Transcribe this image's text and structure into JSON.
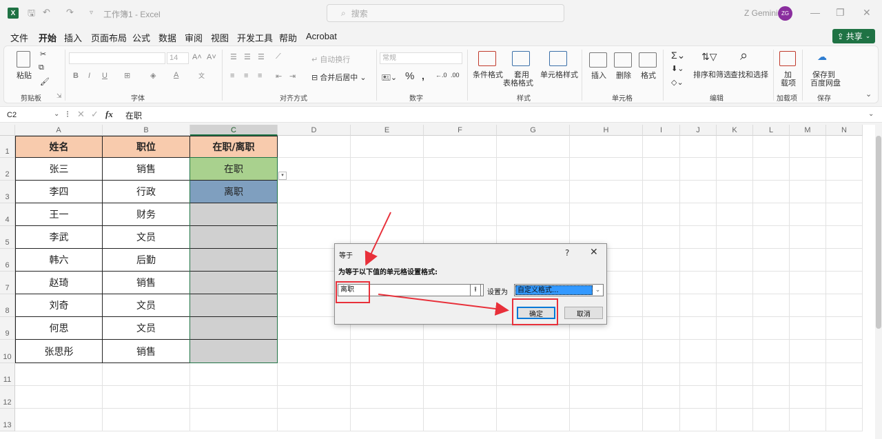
{
  "titlebar": {
    "title": "工作簿1 - Excel",
    "search_placeholder": "搜索",
    "user_name": "Z Gemini",
    "avatar_initials": "ZG"
  },
  "menu": {
    "items": [
      "文件",
      "开始",
      "插入",
      "页面布局",
      "公式",
      "数据",
      "审阅",
      "视图",
      "开发工具",
      "帮助",
      "Acrobat"
    ],
    "active": "开始",
    "share_label": "共享"
  },
  "ribbon": {
    "paste": "粘贴",
    "font_size": "14",
    "wrap_text": "自动换行",
    "merge_center": "合并后居中",
    "number_format": "常规",
    "conditional_format": "条件格式",
    "table_format_1": "套用",
    "table_format_2": "表格格式",
    "cell_style": "单元格样式",
    "insert": "插入",
    "delete": "删除",
    "format": "格式",
    "sort_filter": "排序和筛选",
    "find_select": "查找和选择",
    "addins_1": "加",
    "addins_2": "载项",
    "save_baidu_1": "保存到",
    "save_baidu_2": "百度网盘",
    "groups": {
      "clipboard": "剪贴板",
      "font": "字体",
      "alignment": "对齐方式",
      "number": "数字",
      "styles": "样式",
      "cells": "单元格",
      "editing": "编辑",
      "addins": "加载项",
      "save": "保存"
    }
  },
  "formula_bar": {
    "name_box": "C2",
    "fx": "fx",
    "value": "在职"
  },
  "sheet": {
    "columns": [
      "A",
      "B",
      "C",
      "D",
      "E",
      "F",
      "G",
      "H",
      "I",
      "J",
      "K",
      "L",
      "M",
      "N"
    ],
    "rows": [
      "1",
      "2",
      "3",
      "4",
      "5",
      "6",
      "7",
      "8",
      "9",
      "10",
      "11",
      "12",
      "13"
    ],
    "header": [
      "姓名",
      "职位",
      "在职/离职"
    ],
    "data": [
      [
        "张三",
        "销售",
        "在职"
      ],
      [
        "李四",
        "行政",
        "离职"
      ],
      [
        "王一",
        "财务",
        ""
      ],
      [
        "李武",
        "文员",
        ""
      ],
      [
        "韩六",
        "后勤",
        ""
      ],
      [
        "赵琦",
        "销售",
        ""
      ],
      [
        "刘奇",
        "文员",
        ""
      ],
      [
        "何思",
        "文员",
        ""
      ],
      [
        "张思彤",
        "销售",
        ""
      ]
    ],
    "colors": {
      "header_fill": "#f8cbad",
      "active_fill": "#a9d18e",
      "resigned_fill": "#7f9fbf",
      "range_fill": "#d0d0d0"
    }
  },
  "dialog": {
    "title": "等于",
    "help": "?",
    "close": "✕",
    "label": "为等于以下值的单元格设置格式:",
    "input_value": "离职",
    "set_as": "设置为",
    "format_value": "自定义格式...",
    "ok": "确定",
    "cancel": "取消"
  }
}
